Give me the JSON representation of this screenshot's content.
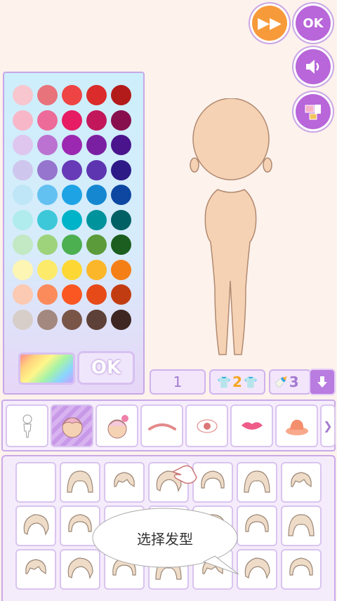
{
  "top_buttons": {
    "skip_icon": "fast-forward-icon",
    "ok_label": "OK",
    "sound_icon": "speaker-icon",
    "gallery_icon": "gallery-icon"
  },
  "palette": {
    "ok_label": "OK",
    "rainbow_icon": "rainbow-gradient-icon",
    "rows": [
      [
        "#f7c6cf",
        "#e8737b",
        "#ef4444",
        "#db2b2b",
        "#b31b1b"
      ],
      [
        "#f7b7c9",
        "#ed6b99",
        "#e61d63",
        "#c2185b",
        "#870f4e"
      ],
      [
        "#dec6ee",
        "#bb72d0",
        "#9c27b0",
        "#7b1fa2",
        "#4a148c"
      ],
      [
        "#cfc6ee",
        "#9575cd",
        "#673ab7",
        "#5e35b1",
        "#2e1a87"
      ],
      [
        "#bfe6f6",
        "#62c1f1",
        "#1ea3e4",
        "#1587d1",
        "#0d47a1"
      ],
      [
        "#b0ecee",
        "#3cc8d9",
        "#00b3c8",
        "#00939c",
        "#006064"
      ],
      [
        "#c2e8c4",
        "#9ed37c",
        "#4caf50",
        "#5c9b3a",
        "#1b5e20"
      ],
      [
        "#fdf5b3",
        "#fcea6a",
        "#fdd835",
        "#fbb62a",
        "#f57f17"
      ],
      [
        "#fcc9b2",
        "#fc8b5b",
        "#fb5722",
        "#e64a19",
        "#c23c12"
      ],
      [
        "#d7cec9",
        "#a2887e",
        "#795548",
        "#5d4037",
        "#3e2723"
      ]
    ]
  },
  "tabs": [
    {
      "label": "1",
      "icon": ""
    },
    {
      "label": "2",
      "icon": "shirt-icon"
    },
    {
      "label": "3",
      "icon": "pacifier-icon"
    }
  ],
  "scroll_down_icon": "arrow-down-icon",
  "categories": [
    "body-icon",
    "hair-face-icon",
    "hair-accessory-icon",
    "eyebrow-icon",
    "eye-icon",
    "lips-icon",
    "hat-icon",
    "more-icon"
  ],
  "hair_grid": {
    "columns": 7,
    "rows": 3
  },
  "tooltip": {
    "text": "选择发型"
  }
}
